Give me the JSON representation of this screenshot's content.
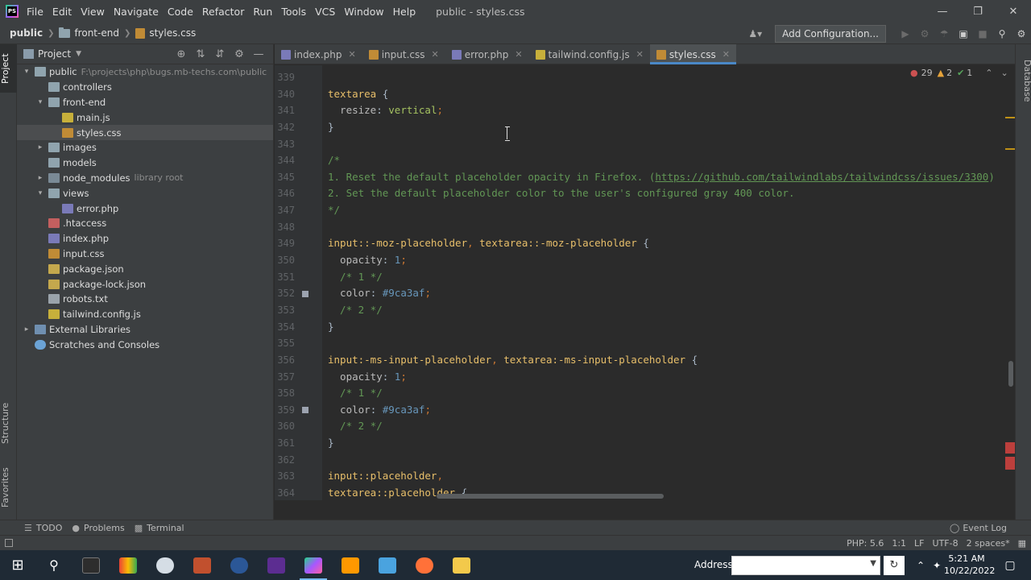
{
  "app": {
    "logo_text": "PS",
    "window_title": "public - styles.css",
    "menu": [
      "File",
      "Edit",
      "View",
      "Navigate",
      "Code",
      "Refactor",
      "Run",
      "Tools",
      "VCS",
      "Window",
      "Help"
    ]
  },
  "breadcrumb": [
    "public",
    "front-end",
    "styles.css"
  ],
  "toolbar": {
    "add_configuration": "Add Configuration..."
  },
  "side_tabs": {
    "project": "Project",
    "structure": "Structure",
    "favorites": "Favorites",
    "database": "Database"
  },
  "project_panel": {
    "title": "Project",
    "tree": [
      {
        "label": "public",
        "hint": "F:\\projects\\php\\bugs.mb-techs.com\\public",
        "level": 0,
        "arrow": "open",
        "icon": "folder"
      },
      {
        "label": "controllers",
        "level": 1,
        "arrow": "none",
        "icon": "folder"
      },
      {
        "label": "front-end",
        "level": 1,
        "arrow": "open",
        "icon": "folder"
      },
      {
        "label": "main.js",
        "level": 2,
        "arrow": "none",
        "icon": "js"
      },
      {
        "label": "styles.css",
        "level": 2,
        "arrow": "none",
        "icon": "cssf",
        "selected": true
      },
      {
        "label": "images",
        "level": 1,
        "arrow": "closed",
        "icon": "folder"
      },
      {
        "label": "models",
        "level": 1,
        "arrow": "none",
        "icon": "folder"
      },
      {
        "label": "node_modules",
        "hint": "library root",
        "level": 1,
        "arrow": "closed",
        "icon": "folder-dark"
      },
      {
        "label": "views",
        "level": 1,
        "arrow": "open",
        "icon": "folder"
      },
      {
        "label": "error.php",
        "level": 2,
        "arrow": "none",
        "icon": "php"
      },
      {
        "label": ".htaccess",
        "level": 1,
        "arrow": "none",
        "icon": "ht"
      },
      {
        "label": "index.php",
        "level": 1,
        "arrow": "none",
        "icon": "php"
      },
      {
        "label": "input.css",
        "level": 1,
        "arrow": "none",
        "icon": "cssf"
      },
      {
        "label": "package.json",
        "level": 1,
        "arrow": "none",
        "icon": "json"
      },
      {
        "label": "package-lock.json",
        "level": 1,
        "arrow": "none",
        "icon": "json"
      },
      {
        "label": "robots.txt",
        "level": 1,
        "arrow": "none",
        "icon": "txt"
      },
      {
        "label": "tailwind.config.js",
        "level": 1,
        "arrow": "none",
        "icon": "js"
      },
      {
        "label": "External Libraries",
        "level": 0,
        "arrow": "closed",
        "icon": "lib"
      },
      {
        "label": "Scratches and Consoles",
        "level": 0,
        "arrow": "none",
        "icon": "scratch"
      }
    ]
  },
  "tabs": [
    {
      "label": "index.php",
      "icon": "php"
    },
    {
      "label": "input.css",
      "icon": "cssf"
    },
    {
      "label": "error.php",
      "icon": "php"
    },
    {
      "label": "tailwind.config.js",
      "icon": "js"
    },
    {
      "label": "styles.css",
      "icon": "cssf",
      "active": true
    }
  ],
  "inspections": {
    "errors": "29",
    "warnings": "2",
    "ok": "1"
  },
  "editor": {
    "lines": [
      {
        "n": "339",
        "t": []
      },
      {
        "n": "340",
        "t": [
          [
            "c-sel",
            "textarea"
          ],
          [
            "c-brace",
            " {"
          ]
        ]
      },
      {
        "n": "341",
        "t": [
          [
            "c-prop",
            "  resize"
          ],
          [
            "c-brace",
            ": "
          ],
          [
            "c-val",
            "vertical"
          ],
          [
            "c-punc",
            ";"
          ]
        ]
      },
      {
        "n": "342",
        "t": [
          [
            "c-brace",
            "}"
          ]
        ]
      },
      {
        "n": "343",
        "t": []
      },
      {
        "n": "344",
        "t": [
          [
            "c-com",
            "/*"
          ]
        ]
      },
      {
        "n": "345",
        "t": [
          [
            "c-com",
            "1. Reset the default placeholder opacity in Firefox. ("
          ],
          [
            "c-link",
            "https://github.com/tailwindlabs/tailwindcss/issues/3300"
          ],
          [
            "c-com",
            ")"
          ]
        ]
      },
      {
        "n": "346",
        "t": [
          [
            "c-com",
            "2. Set the default placeholder color to the user's configured gray 400 color."
          ]
        ]
      },
      {
        "n": "347",
        "t": [
          [
            "c-com",
            "*/"
          ]
        ]
      },
      {
        "n": "348",
        "t": []
      },
      {
        "n": "349",
        "t": [
          [
            "c-sel",
            "input::-moz-placeholder"
          ],
          [
            "c-punc",
            ", "
          ],
          [
            "c-sel",
            "textarea::-moz-placeholder"
          ],
          [
            "c-brace",
            " {"
          ]
        ]
      },
      {
        "n": "350",
        "t": [
          [
            "c-prop",
            "  opacity"
          ],
          [
            "c-brace",
            ": "
          ],
          [
            "c-num",
            "1"
          ],
          [
            "c-punc",
            ";"
          ]
        ]
      },
      {
        "n": "351",
        "t": [
          [
            "c-com",
            "  /* 1 */"
          ]
        ]
      },
      {
        "n": "352",
        "t": [
          [
            "c-prop",
            "  color"
          ],
          [
            "c-brace",
            ": "
          ],
          [
            "c-num",
            "#9ca3af"
          ],
          [
            "c-punc",
            ";"
          ]
        ]
      },
      {
        "n": "353",
        "t": [
          [
            "c-com",
            "  /* 2 */"
          ]
        ]
      },
      {
        "n": "354",
        "t": [
          [
            "c-brace",
            "}"
          ]
        ]
      },
      {
        "n": "355",
        "t": []
      },
      {
        "n": "356",
        "t": [
          [
            "c-sel",
            "input:-ms-input-placeholder"
          ],
          [
            "c-punc",
            ", "
          ],
          [
            "c-sel",
            "textarea:-ms-input-placeholder"
          ],
          [
            "c-brace",
            " {"
          ]
        ]
      },
      {
        "n": "357",
        "t": [
          [
            "c-prop",
            "  opacity"
          ],
          [
            "c-brace",
            ": "
          ],
          [
            "c-num",
            "1"
          ],
          [
            "c-punc",
            ";"
          ]
        ]
      },
      {
        "n": "358",
        "t": [
          [
            "c-com",
            "  /* 1 */"
          ]
        ]
      },
      {
        "n": "359",
        "t": [
          [
            "c-prop",
            "  color"
          ],
          [
            "c-brace",
            ": "
          ],
          [
            "c-num",
            "#9ca3af"
          ],
          [
            "c-punc",
            ";"
          ]
        ]
      },
      {
        "n": "360",
        "t": [
          [
            "c-com",
            "  /* 2 */"
          ]
        ]
      },
      {
        "n": "361",
        "t": [
          [
            "c-brace",
            "}"
          ]
        ]
      },
      {
        "n": "362",
        "t": []
      },
      {
        "n": "363",
        "t": [
          [
            "c-sel",
            "input::placeholder"
          ],
          [
            "c-punc",
            ","
          ]
        ]
      },
      {
        "n": "364",
        "t": [
          [
            "c-sel",
            "textarea::placeholder"
          ],
          [
            "c-brace",
            " {"
          ]
        ]
      }
    ]
  },
  "bottom_tools": [
    "TODO",
    "Problems",
    "Terminal"
  ],
  "event_log": "Event Log",
  "status": {
    "php": "PHP: 5.6",
    "position": "1:1",
    "line_sep": "LF",
    "encoding": "UTF-8",
    "indent": "2 spaces*"
  },
  "taskbar": {
    "address_label": "Address",
    "address_value": "",
    "time": "5:21 AM",
    "date": "10/22/2022"
  },
  "colors": {
    "accent": "#4a88c7",
    "error": "#cc5151",
    "warning": "#e6a33a",
    "chip": "#9ca3af"
  }
}
